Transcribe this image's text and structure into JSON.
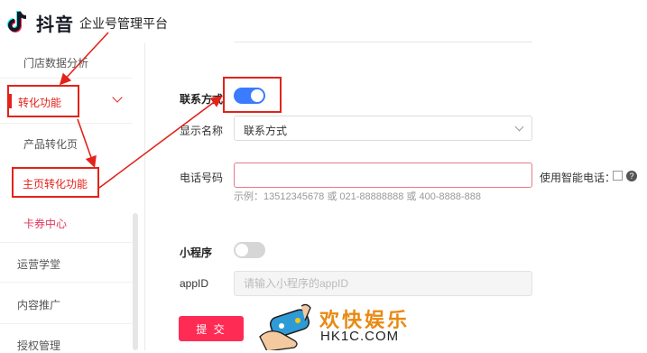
{
  "header": {
    "brand": "抖音",
    "platform": "企业号管理平台"
  },
  "sidebar": {
    "items": [
      {
        "label": "门店数据分析"
      },
      {
        "label": "转化功能"
      },
      {
        "label": "产品转化页"
      },
      {
        "label": "主页转化功能"
      },
      {
        "label": "卡券中心"
      },
      {
        "label": "运营学堂"
      },
      {
        "label": "内容推广"
      },
      {
        "label": "授权管理"
      }
    ]
  },
  "form": {
    "contact": {
      "label": "联系方式",
      "enabled": true
    },
    "display_name": {
      "label": "显示名称",
      "value": "联系方式"
    },
    "phone": {
      "label": "电话号码",
      "value": "",
      "hint": "示例：13512345678 或 021-88888888 或 400-8888-888",
      "smart_label": "使用智能电话："
    },
    "mini_program": {
      "label": "小程序",
      "enabled": false
    },
    "appid": {
      "label": "appID",
      "placeholder": "请输入小程序的appID"
    },
    "submit_label": "提 交"
  },
  "watermark": {
    "title": "欢快娱乐",
    "url": "HK1C.COM"
  },
  "colors": {
    "accent": "#fe2c55",
    "annotation": "#e2231a",
    "toggle_on": "#3a7bff"
  }
}
